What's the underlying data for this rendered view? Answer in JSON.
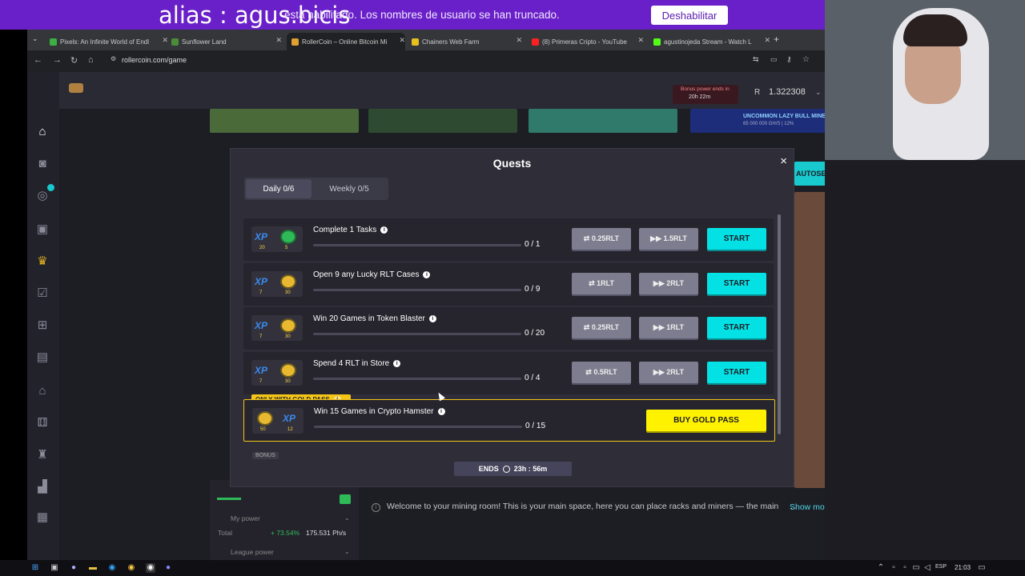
{
  "overlay": {
    "alias": "alias : agus.bicis"
  },
  "notice": {
    "text": "está habilitado. Los nombres de usuario se han truncado.",
    "button": "Deshabilitar"
  },
  "browser": {
    "tabs": [
      {
        "label": "Pixels: An Infinite World of Endl"
      },
      {
        "label": "Sunflower Land"
      },
      {
        "label": "RollerCoin – Online Bitcoin Mi"
      },
      {
        "label": "Chainers Web Farm"
      },
      {
        "label": "(8) Primeras Cripto - YouTube"
      },
      {
        "label": "agustinojeda Stream - Watch L"
      }
    ],
    "url": "rollercoin.com/game"
  },
  "header": {
    "bonus_label": "Bonus power ends in",
    "bonus_timer": "20h 22m",
    "balance": "1.322308"
  },
  "modal": {
    "title": "Quests",
    "close": "×",
    "tabs": [
      {
        "label": "Daily 0/6"
      },
      {
        "label": "Weekly 0/5"
      }
    ],
    "quests": [
      {
        "title": "Complete 1 Tasks",
        "xp": "20",
        "coin": "5",
        "progress": "0 / 1",
        "btn1": "⇄ 0.25RLT",
        "btn2": "▶▶ 1.5RLT",
        "start": "START"
      },
      {
        "title": "Open 9 any Lucky RLT Cases",
        "xp": "7",
        "coin": "30",
        "progress": "0 / 9",
        "btn1": "⇄ 1RLT",
        "btn2": "▶▶ 2RLT",
        "start": "START"
      },
      {
        "title": "Win 20 Games in Token Blaster",
        "xp": "7",
        "coin": "30",
        "progress": "0 / 20",
        "btn1": "⇄ 0.25RLT",
        "btn2": "▶▶ 1RLT",
        "start": "START"
      },
      {
        "title": "Spend 4 RLT in Store",
        "xp": "7",
        "coin": "30",
        "progress": "0 / 4",
        "btn1": "⇄ 0.5RLT",
        "btn2": "▶▶ 2RLT",
        "start": "START"
      }
    ],
    "gold": {
      "tag": "ONLY WITH GOLD PASS",
      "title": "Win 15 Games in Crypto Hamster",
      "coin": "50",
      "xp": "12",
      "progress": "0 / 15",
      "button": "BUY GOLD PASS"
    },
    "bonus_label": "BONUS",
    "ends_label": "ENDS",
    "ends_time": "23h : 56m"
  },
  "page": {
    "welcome": "Welcome to your mining room! This is your main space, here you can place racks and miners — the main",
    "ellipsis": "...",
    "show_more": "Show more",
    "autoset": "AUTOSET",
    "banner": "UNCOMMON LAZY BULL MINER",
    "banner_sub": "65 000 000 GH/S | 12%"
  },
  "power": {
    "my_power": "My power",
    "total_label": "Total",
    "total_pct": "+ 73.54%",
    "total_value": "175.531 Ph/s",
    "league": "League power"
  },
  "taskbar": {
    "lang": "ESP",
    "time": "21:03"
  }
}
